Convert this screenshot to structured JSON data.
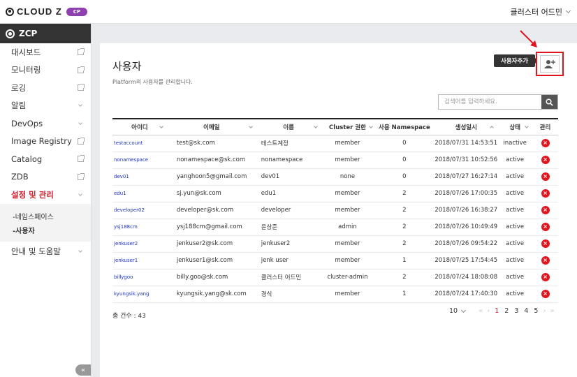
{
  "app": {
    "logo_text": "CLOUD Z",
    "logo_badge": "CP",
    "user_name": "클러스터 어드민"
  },
  "sidebar": {
    "brand": "ZCP",
    "items": [
      {
        "label": "대시보드",
        "icon": "external-link-icon"
      },
      {
        "label": "모니터링",
        "icon": "external-link-icon"
      },
      {
        "label": "로깅",
        "icon": "external-link-icon"
      },
      {
        "label": "알림",
        "icon": "chevron-down-icon"
      },
      {
        "label": "DevOps",
        "icon": "chevron-down-icon"
      },
      {
        "label": "Image Registry",
        "icon": "external-link-icon"
      },
      {
        "label": "Catalog",
        "icon": "external-link-icon"
      },
      {
        "label": "ZDB",
        "icon": "external-link-icon"
      },
      {
        "label": "설정 및 관리",
        "icon": "chevron-down-icon"
      }
    ],
    "submenu": [
      "-네임스페이스",
      "-사용자"
    ],
    "help": "안내 및 도움말",
    "collapse": "«"
  },
  "main": {
    "title": "사용자",
    "description": "Platform의 사용자를 관리합니다.",
    "add_tooltip": "사용자추가",
    "search_placeholder": "검색어를 입력하세요.",
    "columns": [
      "아이디",
      "이메일",
      "이름",
      "Cluster 권한",
      "사용 Namespace",
      "생성일시",
      "상태",
      "관리"
    ],
    "rows": [
      {
        "id": "testaccount",
        "email": "test@sk.com",
        "name": "테스트계정",
        "role": "member",
        "ns": "0",
        "created": "2018/07/31 14:53:51",
        "status": "inactive"
      },
      {
        "id": "nonamespace",
        "email": "nonamespace@sk.com",
        "name": "nonamespace",
        "role": "member",
        "ns": "0",
        "created": "2018/07/31 10:52:56",
        "status": "active"
      },
      {
        "id": "dev01",
        "email": "yanghoon5@gmail.com",
        "name": "dev01",
        "role": "none",
        "ns": "0",
        "created": "2018/07/27 16:27:14",
        "status": "active"
      },
      {
        "id": "edu1",
        "email": "sj.yun@sk.com",
        "name": "edu1",
        "role": "member",
        "ns": "2",
        "created": "2018/07/26 17:00:35",
        "status": "active"
      },
      {
        "id": "developer02",
        "email": "developer@sk.com",
        "name": "developer",
        "role": "member",
        "ns": "2",
        "created": "2018/07/26 16:38:27",
        "status": "active"
      },
      {
        "id": "ysj188cm",
        "email": "ysj188cm@gmail.com",
        "name": "윤상준",
        "role": "admin",
        "ns": "2",
        "created": "2018/07/26 10:49:49",
        "status": "active"
      },
      {
        "id": "jenkuser2",
        "email": "jenkuser2@sk.com",
        "name": "jenkuser2",
        "role": "member",
        "ns": "2",
        "created": "2018/07/26 09:54:22",
        "status": "active"
      },
      {
        "id": "jenkuser1",
        "email": "jenkuser1@sk.com",
        "name": "jenk user",
        "role": "member",
        "ns": "1",
        "created": "2018/07/25 17:54:45",
        "status": "active"
      },
      {
        "id": "billygoo",
        "email": "billy.goo@sk.com",
        "name": "클러스터 어드민",
        "role": "cluster-admin",
        "ns": "2",
        "created": "2018/07/24 18:08:08",
        "status": "active"
      },
      {
        "id": "kyungsik.yang",
        "email": "kyungsik.yang@sk.com",
        "name": "경식",
        "role": "member",
        "ns": "1",
        "created": "2018/07/24 17:40:30",
        "status": "active"
      }
    ],
    "delete_symbol": "×",
    "total_label": "총 건수 : 43",
    "page_size": "10",
    "pages": [
      "1",
      "2",
      "3",
      "4",
      "5"
    ],
    "current_page": "1",
    "nav": {
      "first": "«",
      "prev": "‹",
      "next": "›",
      "last": "»"
    }
  },
  "colors": {
    "accent_red": "#e3141e",
    "link_blue": "#1a33c2",
    "badge_purple": "#8e3fb0"
  }
}
